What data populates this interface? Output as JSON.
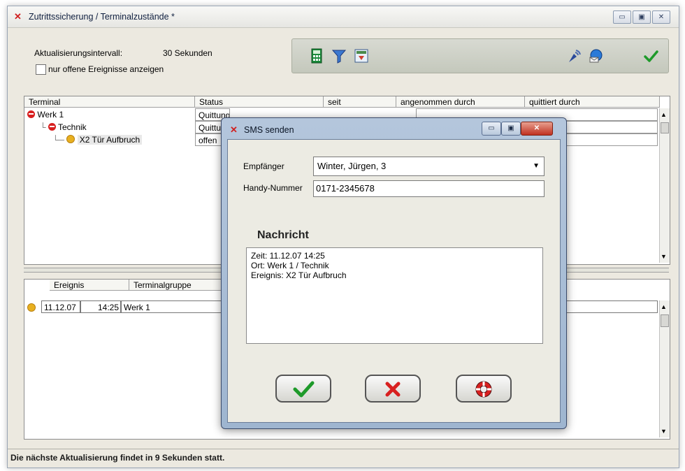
{
  "window": {
    "title": "Zutrittssicherung / Terminalzustände *",
    "controls": {
      "minimize": "▭",
      "restore": "▣",
      "close": "✕"
    }
  },
  "settings": {
    "interval_label": "Aktualisierungsintervall:",
    "interval_value": "30 Sekunden",
    "only_open_label": "nur offene Ereignisse anzeigen"
  },
  "toolbar": {
    "icons": [
      "calculator-icon",
      "filter-icon",
      "export-icon",
      "radio-signal-icon",
      "mail-globe-icon",
      "checkmark-icon"
    ]
  },
  "terminal_grid": {
    "columns": [
      "Terminal",
      "Status",
      "seit",
      "angenommen durch",
      "quittiert durch"
    ],
    "rows": [
      {
        "name": "Werk 1",
        "status": "Quittung fehlt"
      },
      {
        "name": "Technik",
        "status": "Quittung fehlt"
      },
      {
        "name": "X2 Tür Aufbruch",
        "status": "offen"
      }
    ]
  },
  "event_grid": {
    "columns": [
      "Ereignis",
      "Terminalgruppe"
    ],
    "rows": [
      {
        "date": "11.12.07",
        "time": "14:25",
        "group": "Werk 1"
      }
    ]
  },
  "statusbar": {
    "text": "Die nächste Aktualisierung findet in 9 Sekunden statt."
  },
  "sms_dialog": {
    "title": "SMS senden",
    "recipient_label": "Empfänger",
    "recipient_value": "Winter, Jürgen, 3",
    "phone_label": "Handy-Nummer",
    "phone_value": "0171-2345678",
    "message_heading": "Nachricht",
    "message_lines": [
      "Zeit: 11.12.07  14:25",
      "Ort: Werk 1 / Technik",
      "Ereignis: X2 Tür Aufbruch"
    ],
    "buttons": [
      "confirm",
      "cancel",
      "help"
    ]
  },
  "colors": {
    "accent_green": "#1e9a2a",
    "alarm_red": "#d82020",
    "warning_yellow": "#e8b020"
  }
}
